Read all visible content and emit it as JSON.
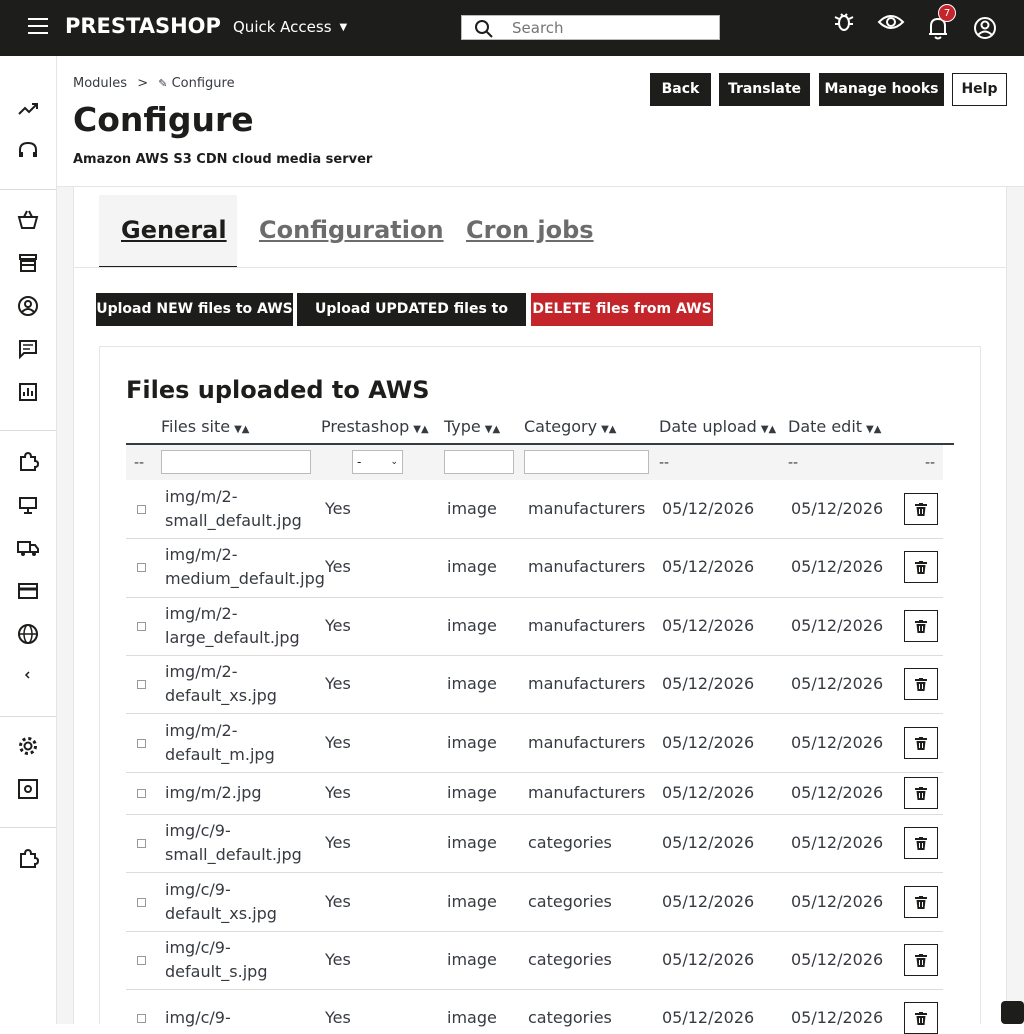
{
  "topbar": {
    "brand": "PRESTASHOP",
    "quick_access": "Quick Access",
    "search_placeholder": "Search",
    "notification_count": "7"
  },
  "breadcrumb": {
    "parent": "Modules",
    "separator": ">",
    "current": "Configure"
  },
  "page": {
    "title": "Configure",
    "subtitle": "Amazon AWS S3 CDN cloud media server"
  },
  "header_buttons": {
    "back": "Back",
    "translate": "Translate",
    "manage_hooks": "Manage hooks",
    "help": "Help"
  },
  "tabs": [
    {
      "label": "General",
      "active": true
    },
    {
      "label": "Configuration",
      "active": false
    },
    {
      "label": "Cron jobs",
      "active": false
    }
  ],
  "actions": {
    "upload_new": "Upload NEW files to AWS",
    "upload_updated": "Upload UPDATED files to AWS",
    "delete": "DELETE files from AWS"
  },
  "table": {
    "title": "Files uploaded to AWS",
    "columns": [
      "Files site",
      "Prestashop",
      "Type",
      "Category",
      "Date upload",
      "Date edit"
    ],
    "filter": {
      "placeholder_dash": "--",
      "select_value": "-"
    },
    "rows": [
      {
        "file1": "img/m/2-",
        "file2": "small_default.jpg",
        "prestashop": "Yes",
        "type": "image",
        "category": "manufacturers",
        "date_upload": "05/12/2026",
        "date_edit": "05/12/2026"
      },
      {
        "file1": "img/m/2-",
        "file2": "medium_default.jpg",
        "prestashop": "Yes",
        "type": "image",
        "category": "manufacturers",
        "date_upload": "05/12/2026",
        "date_edit": "05/12/2026"
      },
      {
        "file1": "img/m/2-",
        "file2": "large_default.jpg",
        "prestashop": "Yes",
        "type": "image",
        "category": "manufacturers",
        "date_upload": "05/12/2026",
        "date_edit": "05/12/2026"
      },
      {
        "file1": "img/m/2-",
        "file2": "default_xs.jpg",
        "prestashop": "Yes",
        "type": "image",
        "category": "manufacturers",
        "date_upload": "05/12/2026",
        "date_edit": "05/12/2026"
      },
      {
        "file1": "img/m/2-",
        "file2": "default_m.jpg",
        "prestashop": "Yes",
        "type": "image",
        "category": "manufacturers",
        "date_upload": "05/12/2026",
        "date_edit": "05/12/2026"
      },
      {
        "file1": "img/m/2.jpg",
        "file2": "",
        "prestashop": "Yes",
        "type": "image",
        "category": "manufacturers",
        "date_upload": "05/12/2026",
        "date_edit": "05/12/2026"
      },
      {
        "file1": "img/c/9-",
        "file2": "small_default.jpg",
        "prestashop": "Yes",
        "type": "image",
        "category": "categories",
        "date_upload": "05/12/2026",
        "date_edit": "05/12/2026"
      },
      {
        "file1": "img/c/9-",
        "file2": "default_xs.jpg",
        "prestashop": "Yes",
        "type": "image",
        "category": "categories",
        "date_upload": "05/12/2026",
        "date_edit": "05/12/2026"
      },
      {
        "file1": "img/c/9-",
        "file2": "default_s.jpg",
        "prestashop": "Yes",
        "type": "image",
        "category": "categories",
        "date_upload": "05/12/2026",
        "date_edit": "05/12/2026"
      },
      {
        "file1": "img/c/9-",
        "file2": "",
        "prestashop": "Yes",
        "type": "image",
        "category": "categories",
        "date_upload": "05/12/2026",
        "date_edit": "05/12/2026"
      }
    ]
  },
  "colors": {
    "dark": "#1d1d1b",
    "danger": "#c3252b",
    "light_bg": "#f4f4f4"
  }
}
